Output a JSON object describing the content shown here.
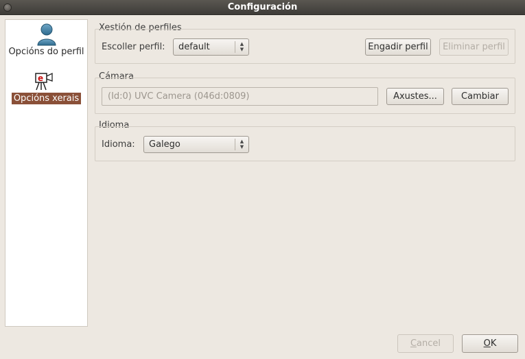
{
  "window": {
    "title": "Configuración"
  },
  "sidebar": {
    "items": [
      {
        "label": "Opcións do perfil",
        "icon": "user-profile-icon",
        "selected": false
      },
      {
        "label": "Opcións xerais",
        "icon": "camera-e-icon",
        "selected": true
      }
    ]
  },
  "profiles": {
    "group_title": "Xestión de perfiles",
    "choose_label": "Escoller perfil:",
    "selected_profile": "default",
    "add_button": "Engadir perfil",
    "remove_button": "Eliminar perfil"
  },
  "camera": {
    "group_title": "Cámara",
    "device_value": "(Id:0) UVC Camera (046d:0809)",
    "settings_button": "Axustes...",
    "change_button": "Cambiar"
  },
  "language": {
    "group_title": "Idioma",
    "label": "Idioma:",
    "selected": "Galego"
  },
  "footer": {
    "cancel_button": "Cancel",
    "cancel_mnemonic": "C",
    "cancel_rest": "ancel",
    "ok_button": "OK",
    "ok_mnemonic": "O",
    "ok_rest": "K"
  },
  "colors": {
    "selection": "#8a5038",
    "window_bg": "#ede8e1",
    "titlebar": "#3e3c38"
  }
}
